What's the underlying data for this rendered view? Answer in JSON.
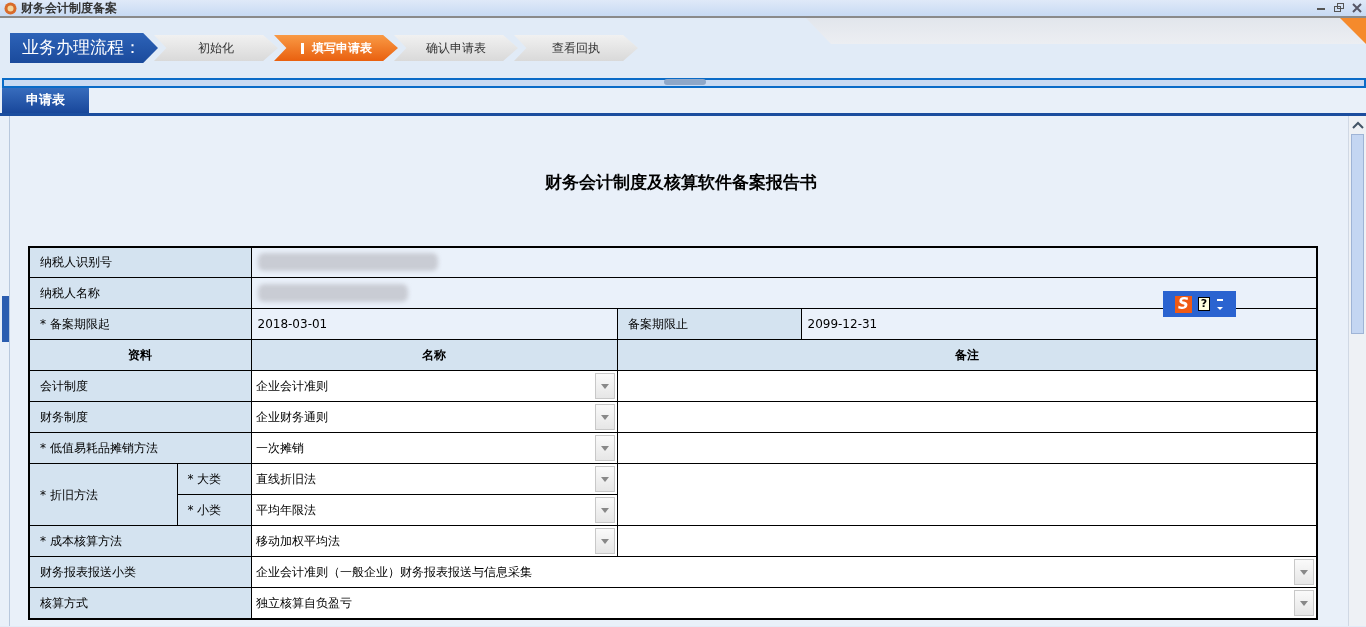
{
  "window": {
    "title": "财务会计制度备案"
  },
  "process": {
    "label": "业务办理流程：",
    "steps": [
      {
        "label": "初始化",
        "selected": false
      },
      {
        "label": "填写申请表",
        "selected": true
      },
      {
        "label": "确认申请表",
        "selected": false
      },
      {
        "label": "查看回执",
        "selected": false
      }
    ]
  },
  "tabs": [
    {
      "label": "申请表",
      "selected": true
    }
  ],
  "form": {
    "title": "财务会计制度及核算软件备案报告书",
    "rows": [
      {
        "kind": "redacted",
        "label": "纳税人识别号"
      },
      {
        "kind": "redacted",
        "label": "纳税人名称"
      },
      {
        "kind": "dates",
        "label": "* 备案期限起",
        "value": "2018-03-01",
        "label_2": "备案期限止",
        "value_2": "2099-12-31"
      },
      {
        "kind": "header",
        "columns": [
          "资料",
          "名称",
          "备注"
        ]
      },
      {
        "kind": "select",
        "label": "会计制度",
        "value": "企业会计准则"
      },
      {
        "kind": "select",
        "label": "财务制度",
        "value": "企业财务通则"
      },
      {
        "kind": "select",
        "label": "* 低值易耗品摊销方法",
        "value": "一次摊销"
      },
      {
        "kind": "split",
        "label": "* 折旧方法",
        "parts": [
          {
            "label": "* 大类",
            "value": "直线折旧法"
          },
          {
            "label": "* 小类",
            "value": "平均年限法"
          }
        ]
      },
      {
        "kind": "select",
        "label": "* 成本核算方法",
        "value": "移动加权平均法"
      },
      {
        "kind": "wide_select",
        "label": "财务报表报送小类",
        "value": "企业会计准则（一般企业）财务报表报送与信息采集"
      },
      {
        "kind": "wide_select",
        "label": "核算方式",
        "value": "独立核算自负盈亏"
      }
    ]
  },
  "ime_toolbar": {
    "logo": "S",
    "help": "?"
  }
}
